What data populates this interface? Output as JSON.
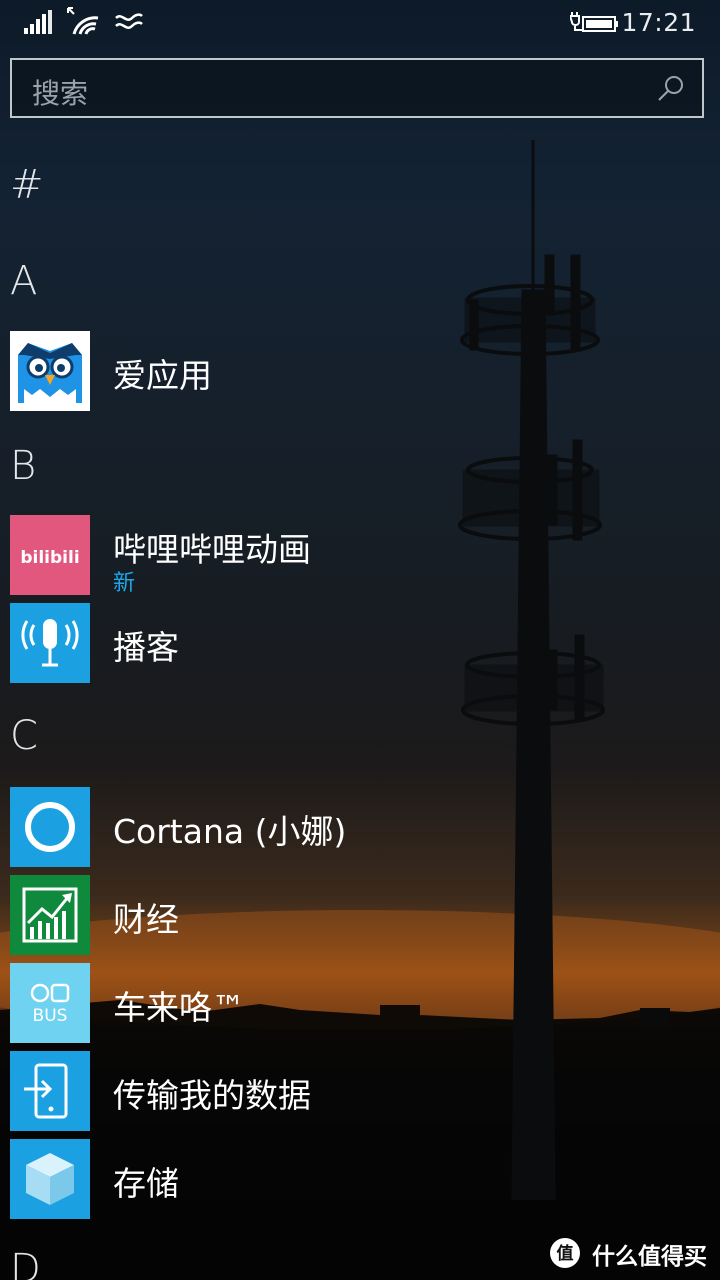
{
  "status_bar": {
    "time": "17:21",
    "icons": [
      "signal-strength-icon",
      "wifi-icon",
      "mobile-data-icon",
      "battery-charging-icon"
    ]
  },
  "search": {
    "placeholder": "搜索",
    "icon": "search-icon"
  },
  "sections": [
    {
      "letter": "#",
      "apps": []
    },
    {
      "letter": "A",
      "apps": [
        {
          "name": "爱应用",
          "icon": "owl-icon",
          "tile_color": "#ffffff"
        }
      ]
    },
    {
      "letter": "B",
      "apps": [
        {
          "name": "哔哩哔哩动画",
          "sub": "新",
          "icon": "bilibili-logo-icon",
          "logo_text": "bilibili",
          "tile_color": "#e2577e"
        },
        {
          "name": "播客",
          "icon": "podcast-microphone-icon",
          "tile_color": "#1ba1e2"
        }
      ]
    },
    {
      "letter": "C",
      "apps": [
        {
          "name": "Cortana (小娜)",
          "icon": "cortana-ring-icon",
          "tile_color": "#1ba1e2"
        },
        {
          "name": "财经",
          "icon": "finance-chart-icon",
          "tile_color": "#0f8a3c"
        },
        {
          "name": "车来咯™",
          "icon": "bus-icon",
          "logo_text": "BUS",
          "tile_color": "#6fd2f0"
        },
        {
          "name": "传输我的数据",
          "icon": "transfer-phone-icon",
          "tile_color": "#1ba1e2"
        },
        {
          "name": "存储",
          "icon": "storage-cube-icon",
          "tile_color": "#1ba1e2"
        }
      ]
    },
    {
      "letter": "D",
      "apps": []
    }
  ],
  "watermark": {
    "text": "什么值得买",
    "icon": "smzdm-logo-icon",
    "logo_char": "值"
  },
  "colors": {
    "accent": "#1ba1e2",
    "text": "#ffffff"
  }
}
